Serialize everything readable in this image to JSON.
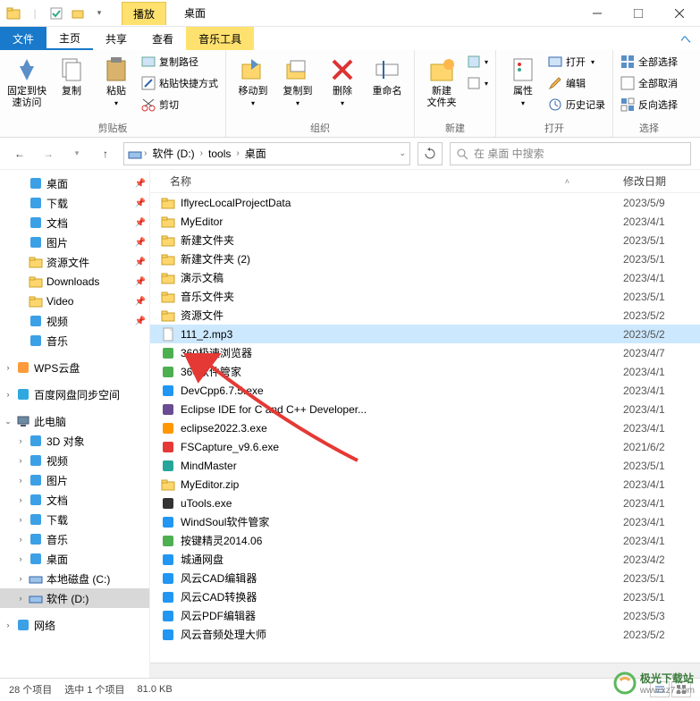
{
  "titlebar": {
    "play_tab": "播放",
    "title": "桌面"
  },
  "tabs": {
    "file": "文件",
    "home": "主页",
    "share": "共享",
    "view": "查看",
    "music": "音乐工具"
  },
  "ribbon": {
    "g1_pin": "固定到快\n速访问",
    "g1_copy": "复制",
    "g1_paste": "粘贴",
    "g1_copypath": "复制路径",
    "g1_pasteshortcut": "粘贴快捷方式",
    "g1_cut": "剪切",
    "g1_label": "剪贴板",
    "g2_moveto": "移动到",
    "g2_copyto": "复制到",
    "g2_delete": "删除",
    "g2_rename": "重命名",
    "g2_label": "组织",
    "g3_newfolder": "新建\n文件夹",
    "g3_label": "新建",
    "g4_props": "属性",
    "g4_open": "打开",
    "g4_edit": "编辑",
    "g4_history": "历史记录",
    "g4_label": "打开",
    "g5_selectall": "全部选择",
    "g5_selectnone": "全部取消",
    "g5_invert": "反向选择",
    "g5_label": "选择"
  },
  "breadcrumb": {
    "seg1": "软件 (D:)",
    "seg2": "tools",
    "seg3": "桌面"
  },
  "search": {
    "placeholder": "在 桌面 中搜索"
  },
  "nav": [
    {
      "label": "桌面",
      "icon": "desktop",
      "indent": 1,
      "pin": true
    },
    {
      "label": "下载",
      "icon": "downloads",
      "indent": 1,
      "pin": true
    },
    {
      "label": "文档",
      "icon": "docs",
      "indent": 1,
      "pin": true
    },
    {
      "label": "图片",
      "icon": "pictures",
      "indent": 1,
      "pin": true
    },
    {
      "label": "资源文件",
      "icon": "folder",
      "indent": 1,
      "pin": true
    },
    {
      "label": "Downloads",
      "icon": "folder",
      "indent": 1,
      "pin": true
    },
    {
      "label": "Video",
      "icon": "folder",
      "indent": 1,
      "pin": true
    },
    {
      "label": "视频",
      "icon": "video",
      "indent": 1,
      "pin": true
    },
    {
      "label": "音乐",
      "icon": "music",
      "indent": 1
    },
    {
      "label": "",
      "icon": "",
      "indent": 0,
      "spacer": true
    },
    {
      "label": "WPS云盘",
      "icon": "wps",
      "indent": 0,
      "exp": ">"
    },
    {
      "label": "",
      "icon": "",
      "indent": 0,
      "spacer": true
    },
    {
      "label": "百度网盘同步空间",
      "icon": "baidu",
      "indent": 0,
      "exp": ">"
    },
    {
      "label": "",
      "icon": "",
      "indent": 0,
      "spacer": true
    },
    {
      "label": "此电脑",
      "icon": "pc",
      "indent": 0,
      "exp": "v"
    },
    {
      "label": "3D 对象",
      "icon": "3d",
      "indent": 1,
      "exp": ">"
    },
    {
      "label": "视频",
      "icon": "video",
      "indent": 1,
      "exp": ">"
    },
    {
      "label": "图片",
      "icon": "pictures",
      "indent": 1,
      "exp": ">"
    },
    {
      "label": "文档",
      "icon": "docs",
      "indent": 1,
      "exp": ">"
    },
    {
      "label": "下载",
      "icon": "downloads",
      "indent": 1,
      "exp": ">"
    },
    {
      "label": "音乐",
      "icon": "music",
      "indent": 1,
      "exp": ">"
    },
    {
      "label": "桌面",
      "icon": "desktop",
      "indent": 1,
      "exp": ">"
    },
    {
      "label": "本地磁盘 (C:)",
      "icon": "drive",
      "indent": 1,
      "exp": ">"
    },
    {
      "label": "软件 (D:)",
      "icon": "drive",
      "indent": 1,
      "exp": ">",
      "selected": true
    },
    {
      "label": "",
      "icon": "",
      "indent": 0,
      "spacer": true
    },
    {
      "label": "网络",
      "icon": "network",
      "indent": 0,
      "exp": ">"
    }
  ],
  "columns": {
    "name": "名称",
    "date": "修改日期"
  },
  "files": [
    {
      "name": "IflyrecLocalProjectData",
      "date": "2023/5/9",
      "icon": "folder"
    },
    {
      "name": "MyEditor",
      "date": "2023/4/1",
      "icon": "folder"
    },
    {
      "name": "新建文件夹",
      "date": "2023/5/1",
      "icon": "folder"
    },
    {
      "name": "新建文件夹 (2)",
      "date": "2023/5/1",
      "icon": "folder"
    },
    {
      "name": "演示文稿",
      "date": "2023/4/1",
      "icon": "folder"
    },
    {
      "name": "音乐文件夹",
      "date": "2023/5/1",
      "icon": "folder"
    },
    {
      "name": "资源文件",
      "date": "2023/5/2",
      "icon": "folder"
    },
    {
      "name": "111_2.mp3",
      "date": "2023/5/2",
      "icon": "file",
      "selected": true
    },
    {
      "name": "360极速浏览器",
      "date": "2023/4/7",
      "icon": "app-green"
    },
    {
      "name": "360软件管家",
      "date": "2023/4/1",
      "icon": "app-green"
    },
    {
      "name": "DevCpp6.7.5.exe",
      "date": "2023/4/1",
      "icon": "app-blue"
    },
    {
      "name": "Eclipse IDE for C and C++ Developer...",
      "date": "2023/4/1",
      "icon": "app-purple"
    },
    {
      "name": "eclipse2022.3.exe",
      "date": "2023/4/1",
      "icon": "app-orange"
    },
    {
      "name": "FSCapture_v9.6.exe",
      "date": "2021/6/2",
      "icon": "app-red"
    },
    {
      "name": "MindMaster",
      "date": "2023/5/1",
      "icon": "app-teal"
    },
    {
      "name": "MyEditor.zip",
      "date": "2023/4/1",
      "icon": "zip"
    },
    {
      "name": "uTools.exe",
      "date": "2023/4/1",
      "icon": "app-dark"
    },
    {
      "name": "WindSoul软件管家",
      "date": "2023/4/1",
      "icon": "app-blue"
    },
    {
      "name": "按键精灵2014.06",
      "date": "2023/4/1",
      "icon": "app-green"
    },
    {
      "name": "城通网盘",
      "date": "2023/4/2",
      "icon": "app-blue"
    },
    {
      "name": "风云CAD编辑器",
      "date": "2023/5/1",
      "icon": "app-blue"
    },
    {
      "name": "风云CAD转换器",
      "date": "2023/5/1",
      "icon": "app-blue"
    },
    {
      "name": "风云PDF编辑器",
      "date": "2023/5/3",
      "icon": "app-blue"
    },
    {
      "name": "风云音频处理大师",
      "date": "2023/5/2",
      "icon": "app-blue"
    }
  ],
  "status": {
    "count": "28 个项目",
    "selection": "选中 1 个项目",
    "size": "81.0 KB"
  },
  "watermark": {
    "text": "极光下载站",
    "url": "www.xz7.com"
  }
}
